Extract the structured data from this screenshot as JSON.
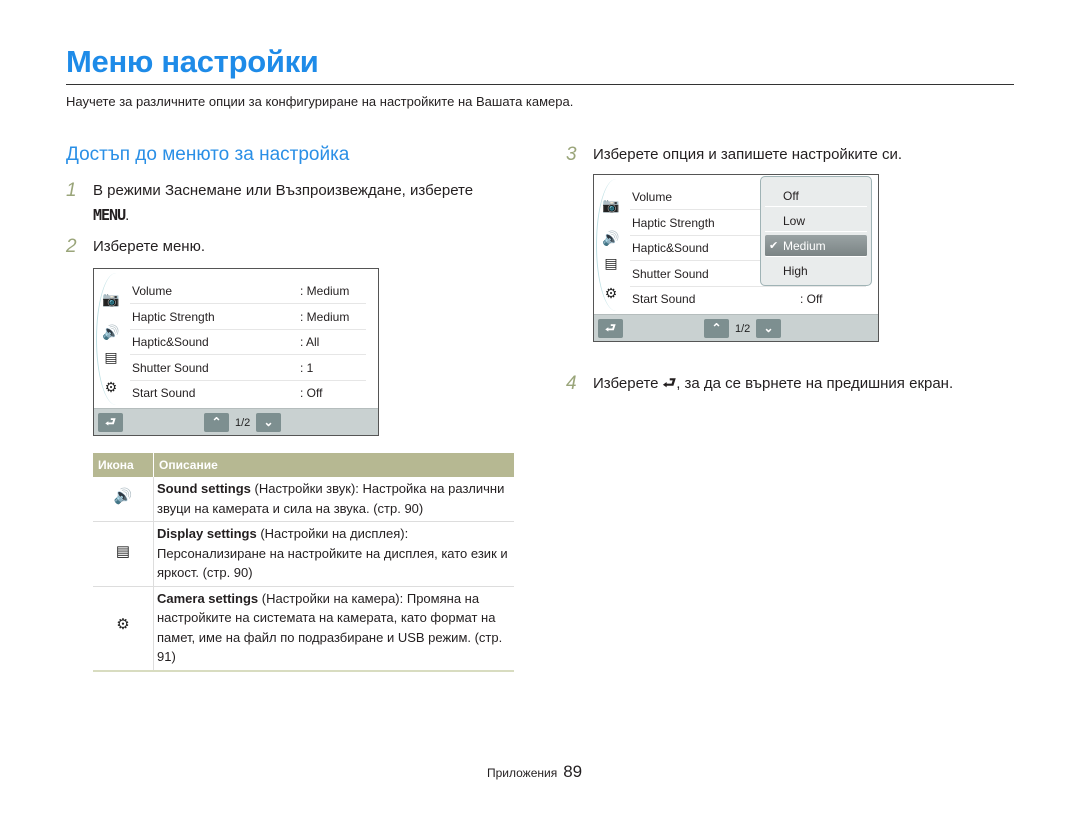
{
  "page": {
    "title": "Меню настройки",
    "intro": "Научете за различните опции за конфигуриране на настройките на Вашата камера.",
    "section_heading": "Достъп до менюто за настройка",
    "footer_label": "Приложения",
    "page_number": "89"
  },
  "steps": [
    {
      "num": "1",
      "text": "В режими Заснемане или Възпроизвеждане, изберете",
      "text_line2_icon": "MENU",
      "text_line2_suffix": "."
    },
    {
      "num": "2",
      "text": "Изберете меню."
    },
    {
      "num": "3",
      "text": "Изберете опция и запишете настройките си."
    },
    {
      "num": "4",
      "text_before": "Изберете",
      "icon": "back-icon",
      "text_after": ", за да се върнете на предишния екран."
    }
  ],
  "screen1": {
    "side_icons": [
      "camera-settings-icon",
      "sound-icon",
      "display-icon",
      "gear-icon"
    ],
    "rows": [
      {
        "label": "Volume",
        "value": ": Medium"
      },
      {
        "label": "Haptic Strength",
        "value": ": Medium"
      },
      {
        "label": "Haptic&Sound",
        "value": ": All"
      },
      {
        "label": "Shutter Sound",
        "value": ": 1"
      },
      {
        "label": "Start Sound",
        "value": ": Off"
      }
    ],
    "page_indicator": "1/2"
  },
  "screen2": {
    "rows": [
      {
        "label": "Volume",
        "value": ""
      },
      {
        "label": "Haptic Strength",
        "value": ""
      },
      {
        "label": "Haptic&Sound",
        "value": ""
      },
      {
        "label": "Shutter Sound",
        "value": ""
      },
      {
        "label": "Start Sound",
        "value": ": Off"
      }
    ],
    "popup_options": [
      "Off",
      "Low",
      "Medium",
      "High"
    ],
    "popup_selected": "Medium",
    "page_indicator": "1/2"
  },
  "table": {
    "headers": [
      "Икона",
      "Описание"
    ],
    "rows": [
      {
        "icon": "sound-icon",
        "title": "Sound settings",
        "text": " (Настройки звук): Настройка на различни звуци на камерата и сила на звука. (стр. 90)"
      },
      {
        "icon": "display-icon",
        "title": "Display settings",
        "text": " (Настройки на дисплея): Персонализиране на настройките на дисплея, като език и яркост. (стр. 90)"
      },
      {
        "icon": "gear-icon",
        "title": "Camera settings",
        "text": " (Настройки на камера): Промяна на настройките на системата на камерата, като формат на памет, име на файл по подразбиране и USB режим. (стр. 91)"
      }
    ]
  },
  "colors": {
    "title": "#1e8be8",
    "table_header": "#b6b892",
    "step_number": "#9aa57a"
  }
}
